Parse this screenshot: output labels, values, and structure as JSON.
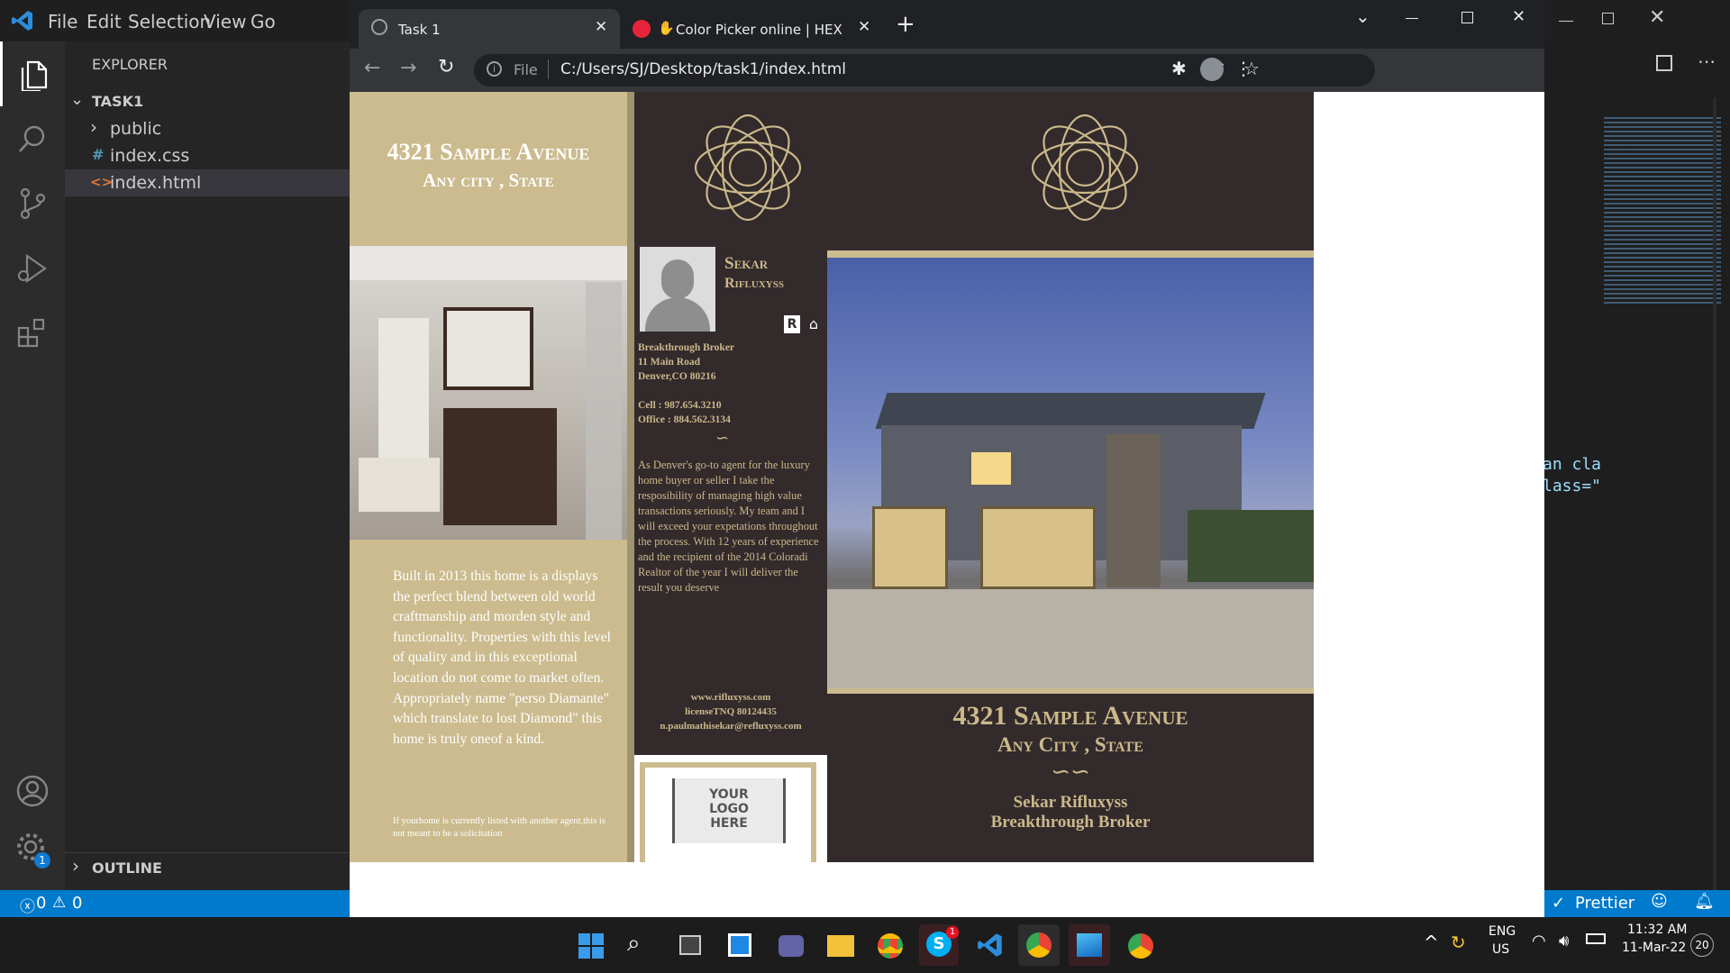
{
  "vscode": {
    "menu": [
      "File",
      "Edit",
      "Selection",
      "View",
      "Go"
    ],
    "explorer_title": "EXPLORER",
    "folder": "TASK1",
    "files": [
      "public",
      "index.css",
      "index.html"
    ],
    "outline": "OUTLINE",
    "status": {
      "errors": "0",
      "warnings": "0",
      "prettier": "Prettier"
    },
    "code_snippet": [
      "an cla",
      "lass=\""
    ],
    "badge": "1"
  },
  "browser": {
    "tabs": [
      {
        "title": "Task 1"
      },
      {
        "title": "Color Picker online | HEX Col"
      }
    ],
    "address_prefix": "File",
    "address": "C:/Users/SJ/Desktop/task1/index.html"
  },
  "brochure": {
    "left": {
      "address_line1": "4321 Sample Avenue",
      "address_line2": "Any city , State",
      "description": "Built in 2013 this home is a displays the perfect blend between old world craftmanship and morden style and functionality. Properties with this level of quality and in this exceptional location do not come to market often. Appropriately name \"perso Diamante\" which translate to lost Diamond\" this home is truly oneof a kind.",
      "disclaimer": "If yourhome is currently listed with another agent,this is not meant to be a solicitation"
    },
    "middle": {
      "agent_first": "Sekar",
      "agent_last": "Rifluxyss",
      "broker": "Breakthrough Broker",
      "street": "11 Main Road",
      "city": "Denver,CO 80216",
      "cell": "Cell : 987.654.3210",
      "office": "Office : 884.562.3134",
      "bio": "As Denver's go-to agent for the luxury home buyer or seller I take the resposibility of managing high value transactions seriously. My team and I will exceed your expetations throughout the process. With 12 years of experience and the recipient of the 2014 Coloradi Realtor of the year I will deliver the result you deserve",
      "website": "www.rifluxyss.com",
      "license": "licenseTNQ 80124435",
      "email": "n.paulmathisekar@refluxyss.com",
      "logo_text": [
        "YOUR",
        "LOGO",
        "HERE"
      ]
    },
    "right": {
      "address_line1": "4321 Sample Avenue",
      "address_line2": "Any City , State",
      "agent": "Sekar Rifluxyss",
      "broker": "Breakthrough Broker"
    }
  },
  "taskbar": {
    "lang": "ENG",
    "region": "US",
    "time": "11:32 AM",
    "date": "11-Mar-22",
    "notif": "20",
    "skype_badge": "1"
  }
}
